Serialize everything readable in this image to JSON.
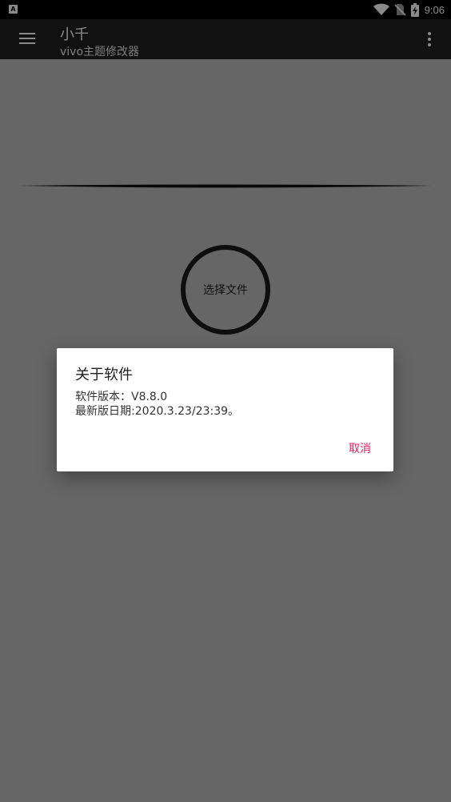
{
  "status_bar": {
    "notification_icon": "A",
    "time": "9:06",
    "icons": [
      "wifi-icon",
      "no-sim-icon",
      "battery-charging-icon"
    ]
  },
  "toolbar": {
    "title": "小千",
    "subtitle": "vivo主题修改器",
    "menu_icon": "hamburger-menu-icon",
    "overflow_icon": "more-vert-icon"
  },
  "main": {
    "select_file_label": "选择文件"
  },
  "dialog": {
    "title": "关于软件",
    "lines": [
      "软件版本：V8.8.0",
      "最新版日期:2020.3.23/23:39。"
    ],
    "cancel_label": "取消"
  },
  "colors": {
    "accent": "#e91e63",
    "toolbar_bg": "#212121",
    "status_bar_bg": "#000000"
  }
}
